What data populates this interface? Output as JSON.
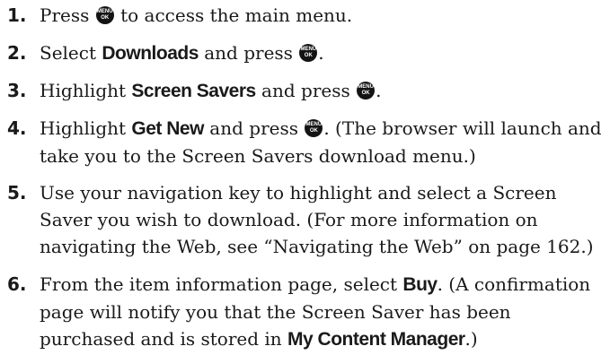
{
  "icon": {
    "name": "menu-ok-key-icon",
    "top": "MENU",
    "bottom": "OK"
  },
  "steps": [
    {
      "num": "1.",
      "a": "Press ",
      "b": " to access the main menu."
    },
    {
      "num": "2.",
      "a": "Select ",
      "b_bold": "Downloads",
      "c": " and press ",
      "d": "."
    },
    {
      "num": "3.",
      "a": "Highlight ",
      "b_bold": "Screen Savers",
      "c": " and press ",
      "d": "."
    },
    {
      "num": "4.",
      "a": "Highlight ",
      "b_bold": "Get New",
      "c": " and press ",
      "d": ". (The browser will launch and take you to the Screen Savers download menu.)"
    },
    {
      "num": "5.",
      "text": "Use your navigation key to highlight and select a Screen Saver you wish to download. (For more information on navigating the Web, see “Navigating the Web” on page 162.)"
    },
    {
      "num": "6.",
      "a": "From the item information page, select ",
      "b_bold": "Buy",
      "c": ". (A confirmation page will notify you that the Screen Saver has been purchased and is stored in ",
      "d_bold": "My Content Manager",
      "e": ".)"
    }
  ]
}
